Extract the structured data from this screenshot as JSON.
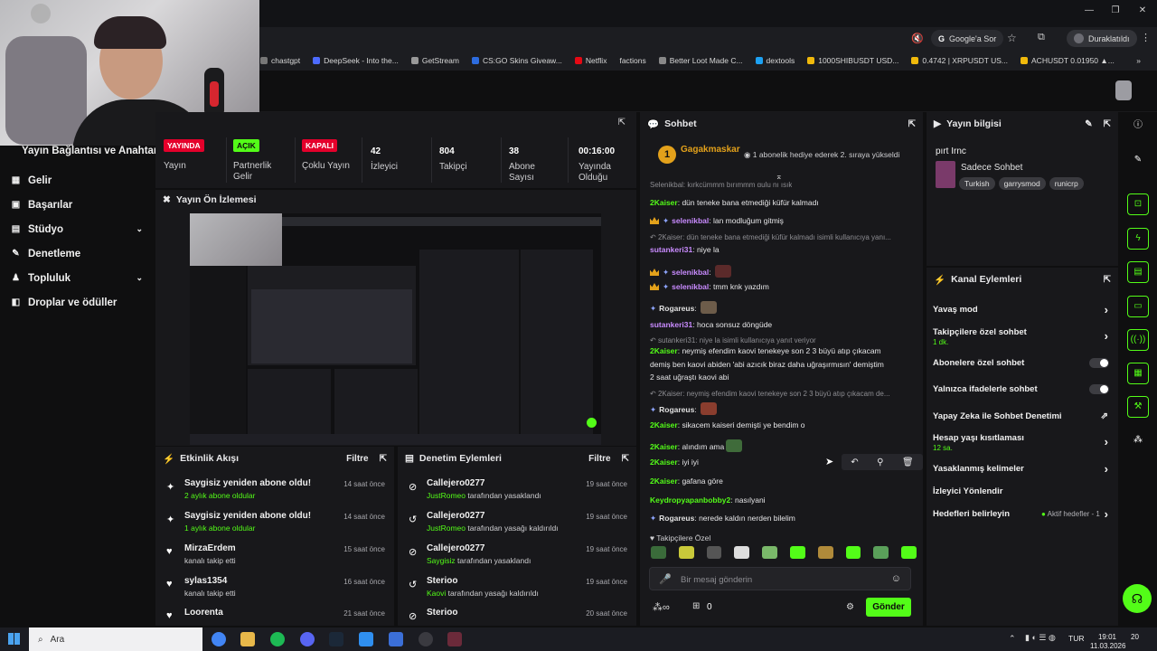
{
  "browser": {
    "address_right": "Google'a Sor",
    "profile": "Duraklatıldı",
    "bookmarks": [
      "chastgpt",
      "DeepSeek - Into the...",
      "GetStream",
      "CS:GO Skins Giveaw...",
      "Netflix",
      "factions",
      "Better Loot Made C...",
      "dextools",
      "1000SHIBUSDT USD...",
      "0.4742 | XRPUSDT US...",
      "ACHUSDT 0.01950 ▲..."
    ]
  },
  "sidebar": {
    "title": "Yayın Bağlantısı ve Anahtarı",
    "items": [
      {
        "label": "Gelir",
        "icon": "revenue-icon"
      },
      {
        "label": "Başarılar",
        "icon": "achievements-icon"
      },
      {
        "label": "Stüdyo",
        "icon": "studio-icon"
      },
      {
        "label": "Denetleme",
        "icon": "moderation-icon"
      },
      {
        "label": "Topluluk",
        "icon": "community-icon"
      },
      {
        "label": "Droplar ve ödüller",
        "icon": "drops-icon"
      }
    ]
  },
  "stats": {
    "stream": {
      "badge": "YAYINDA",
      "label": "Yayın"
    },
    "partner": {
      "badge": "AÇIK",
      "label": "Partnerlik Gelir"
    },
    "multi": {
      "badge": "KAPALI",
      "label": "Çoklu Yayın"
    },
    "viewers": {
      "value": "42",
      "label": "İzleyici"
    },
    "followers": {
      "value": "804",
      "label": "Takipçi"
    },
    "subs": {
      "value": "38",
      "label": "Abone Sayısı"
    },
    "uptime": {
      "value": "00:16:00",
      "label": "Yayında Olduğu"
    }
  },
  "preview": {
    "title": "Yayın Ön İzlemesi"
  },
  "activity": {
    "title": "Etkinlik Akışı",
    "filter": "Filtre",
    "rows": [
      {
        "icon": "star-icon",
        "name": "Saygisiz yeniden abone oldu!",
        "desc": "2 aylık abone oldular",
        "time": "14 saat önce"
      },
      {
        "icon": "star-icon",
        "name": "Saygisiz yeniden abone oldu!",
        "desc": "1 aylık abone oldular",
        "time": "14 saat önce"
      },
      {
        "icon": "heart-icon",
        "name": "MirzaErdem",
        "desc": "kanalı takip etti",
        "time": "15 saat önce"
      },
      {
        "icon": "heart-icon",
        "name": "sylas1354",
        "desc": "kanalı takip etti",
        "time": "16 saat önce"
      },
      {
        "icon": "heart-icon",
        "name": "Loorenta",
        "desc": "",
        "time": "21 saat önce"
      }
    ]
  },
  "modlog": {
    "title": "Denetim Eylemleri",
    "filter": "Filtre",
    "rows": [
      {
        "icon": "ban-icon",
        "name": "Callejero0277",
        "who": "JustRomeo",
        "desc": "tarafından yasaklandı",
        "time": "19 saat önce"
      },
      {
        "icon": "unban-icon",
        "name": "Callejero0277",
        "who": "JustRomeo",
        "desc": "tarafından yasağı kaldırıldı",
        "time": "19 saat önce"
      },
      {
        "icon": "ban-icon",
        "name": "Callejero0277",
        "who": "Saygisiz",
        "desc": "tarafından yasaklandı",
        "time": "19 saat önce"
      },
      {
        "icon": "unban-icon",
        "name": "Sterioo",
        "who": "Kaovi",
        "desc": "tarafından yasağı kaldırıldı",
        "time": "19 saat önce"
      },
      {
        "icon": "ban-icon",
        "name": "Sterioo",
        "who": "",
        "desc": "",
        "time": "20 saat önce"
      }
    ]
  },
  "chat": {
    "title": "Sohbet",
    "pinned": {
      "user": "Gagakmaskar",
      "level": "1",
      "text": "1 abonelik hediye ederek 2. sıraya yükseldi"
    },
    "top_partial": "Selenikbal: kırkcümmm bırımmm gulu nı ışık",
    "messages": [
      {
        "user": "2Kaiser",
        "color": "#53fc18",
        "text": "dün teneke bana etmediği küfür kalmadı"
      },
      {
        "user": "selenikbal",
        "color": "#c98bff",
        "text": "lan modluğum gitmiş",
        "crown": true
      },
      {
        "reply": "2Kaiser: dün teneke bana etmediği küfür kalmadı isimli kullanıcıya yanı..."
      },
      {
        "user": "sutankeri31",
        "color": "#c98bff",
        "text": "niye la"
      },
      {
        "user": "selenikbal",
        "color": "#c98bff",
        "text": "",
        "crown": true,
        "emote": "#5b2a2a"
      },
      {
        "user": "selenikbal",
        "color": "#c98bff",
        "text": "tmm knk yazdım",
        "crown": true
      },
      {
        "user": "Rogareus",
        "color": "#e0e0e0",
        "text": "",
        "emote": "#6d5c4a"
      },
      {
        "user": "sutankeri31",
        "color": "#c98bff",
        "text": "hoca sonsuz döngüde"
      },
      {
        "reply": "sutankeri31: niye la isimli kullanıcıya yanıt veriyor"
      },
      {
        "user": "2Kaiser",
        "color": "#53fc18",
        "text": "neymiş efendim kaovi tenekeye son 2 3 büyü atıp çıkacam"
      },
      {
        "cont": "demiş ben kaovi abiden 'abi azıcık biraz daha uğraşırmısın' demiştim"
      },
      {
        "cont": "2 saat uğraştı kaovi abi"
      },
      {
        "reply": "2Kaiser: neymiş efendim kaovi tenekeye son 2 3 büyü atıp çıkacam de..."
      },
      {
        "user": "Rogareus",
        "color": "#e0e0e0",
        "text": "",
        "emote": "#8a3d2e"
      },
      {
        "user": "2Kaiser",
        "color": "#53fc18",
        "text": "sikacem kaiseri demişti ye bendim o"
      },
      {
        "user": "2Kaiser",
        "color": "#53fc18",
        "text": "alındım ama",
        "emote": "#3f6b3a"
      },
      {
        "user": "2Kaiser",
        "color": "#53fc18",
        "text": "iyi iyi"
      },
      {
        "user": "2Kaiser",
        "color": "#53fc18",
        "text": "gafana göre"
      },
      {
        "user": "Keydropyapanbobby2",
        "color": "#53fc18",
        "text": "nasılyani"
      },
      {
        "user": "Rogareus",
        "color": "#e0e0e0",
        "text": "nerede kaldın nerden bilelim"
      }
    ],
    "followers_only": "Takipçilere Özel",
    "input_placeholder": "Bir mesaj gönderin",
    "points": "0",
    "send": "Gönder"
  },
  "info": {
    "title": "Yayın bilgisi",
    "stream_title": "pırt Irnc",
    "category": "Sadece Sohbet",
    "tags": [
      "Turkish",
      "garrysmod",
      "runicrp"
    ]
  },
  "channel_actions": {
    "title": "Kanal Eylemleri",
    "items": [
      {
        "label": "Yavaş mod",
        "sub": "",
        "kind": "chevron"
      },
      {
        "label": "Takipçilere özel sohbet",
        "sub": "1 dk.",
        "kind": "chevron"
      },
      {
        "label": "Abonelere özel sohbet",
        "sub": "",
        "kind": "toggle"
      },
      {
        "label": "Yalnızca ifadelerle sohbet",
        "sub": "",
        "kind": "toggle"
      },
      {
        "label": "Yapay Zeka ile Sohbet Denetimi",
        "sub": "",
        "kind": "external"
      },
      {
        "label": "Hesap yaşı kısıtlaması",
        "sub": "12 sa.",
        "kind": "chevron"
      },
      {
        "label": "Yasaklanmış kelimeler",
        "sub": "",
        "kind": "chevron"
      },
      {
        "label": "İzleyici Yönlendir",
        "sub": "",
        "kind": "none"
      },
      {
        "label": "Hedefleri belirleyin",
        "sub": "",
        "kind": "goals",
        "extra": "Aktif hedefler - 1"
      }
    ]
  },
  "taskbar": {
    "search": "Ara",
    "lang": "TUR",
    "time": "19:01",
    "date": "11.03.2026",
    "notif": "20"
  },
  "colors": {
    "accent": "#53fc18",
    "live": "#e4002b",
    "bg": "#18181b"
  }
}
